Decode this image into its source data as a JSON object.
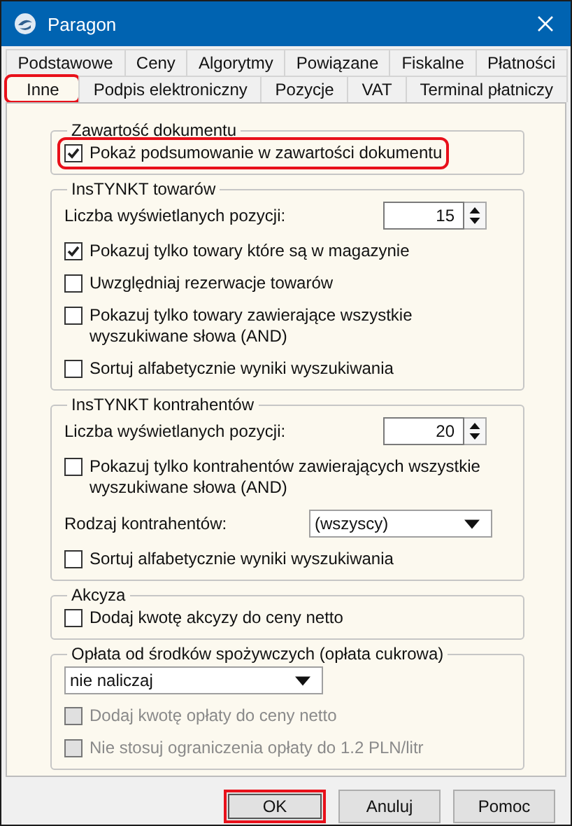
{
  "window": {
    "title": "Paragon"
  },
  "tab_rows": [
    [
      {
        "label": "Podstawowe",
        "selected": false,
        "highlighted": false
      },
      {
        "label": "Ceny",
        "selected": false,
        "highlighted": false
      },
      {
        "label": "Algorytmy",
        "selected": false,
        "highlighted": false
      },
      {
        "label": "Powiązane",
        "selected": false,
        "highlighted": false
      },
      {
        "label": "Fiskalne",
        "selected": false,
        "highlighted": false
      },
      {
        "label": "Płatności",
        "selected": false,
        "highlighted": false
      }
    ],
    [
      {
        "label": "Inne",
        "selected": true,
        "highlighted": true
      },
      {
        "label": "Podpis elektroniczny",
        "selected": false,
        "highlighted": false
      },
      {
        "label": "Pozycje",
        "selected": false,
        "highlighted": false
      },
      {
        "label": "VAT",
        "selected": false,
        "highlighted": false
      },
      {
        "label": "Terminal płatniczy",
        "selected": false,
        "highlighted": false
      }
    ]
  ],
  "groups": [
    {
      "title": "Zawartość dokumentu",
      "items": [
        {
          "kind": "checkbox",
          "label": "Pokaż podsumowanie w zawartości dokumentu",
          "checked": true,
          "disabled": false,
          "highlighted": true
        }
      ]
    },
    {
      "title": "InsTYNKT towarów",
      "items": [
        {
          "kind": "spin",
          "label": "Liczba wyświetlanych pozycji:",
          "value": "15"
        },
        {
          "kind": "checkbox",
          "label": "Pokazuj tylko towary które są w magazynie",
          "checked": true,
          "disabled": false,
          "highlighted": false
        },
        {
          "kind": "checkbox",
          "label": "Uwzględniaj rezerwacje towarów",
          "checked": false,
          "disabled": false,
          "highlighted": false
        },
        {
          "kind": "checkbox",
          "label": "Pokazuj tylko towary zawierające wszystkie wyszukiwane słowa (AND)",
          "checked": false,
          "disabled": false,
          "highlighted": false
        },
        {
          "kind": "checkbox",
          "label": "Sortuj alfabetycznie wyniki wyszukiwania",
          "checked": false,
          "disabled": false,
          "highlighted": false
        }
      ]
    },
    {
      "title": "InsTYNKT kontrahentów",
      "items": [
        {
          "kind": "spin",
          "label": "Liczba wyświetlanych pozycji:",
          "value": "20"
        },
        {
          "kind": "checkbox",
          "label": "Pokazuj tylko kontrahentów zawierających wszystkie wyszukiwane słowa (AND)",
          "checked": false,
          "disabled": false,
          "highlighted": false
        },
        {
          "kind": "select",
          "label": "Rodzaj kontrahentów:",
          "value": "(wszyscy)"
        },
        {
          "kind": "checkbox",
          "label": "Sortuj alfabetycznie wyniki wyszukiwania",
          "checked": false,
          "disabled": false,
          "highlighted": false
        }
      ]
    },
    {
      "title": "Akcyza",
      "items": [
        {
          "kind": "checkbox",
          "label": "Dodaj kwotę akcyzy do ceny netto",
          "checked": false,
          "disabled": false,
          "highlighted": false
        }
      ]
    },
    {
      "title": "Opłata od środków spożywczych (opłata cukrowa)",
      "items": [
        {
          "kind": "select",
          "value": "nie naliczaj"
        },
        {
          "kind": "checkbox",
          "label": "Dodaj kwotę opłaty do ceny netto",
          "checked": false,
          "disabled": true,
          "highlighted": false
        },
        {
          "kind": "checkbox",
          "label": "Nie stosuj ograniczenia opłaty do 1.2 PLN/litr",
          "checked": false,
          "disabled": true,
          "highlighted": false
        }
      ]
    }
  ],
  "buttons": [
    {
      "label": "OK",
      "default": true,
      "highlighted": true
    },
    {
      "label": "Anuluj",
      "default": false,
      "highlighted": false
    },
    {
      "label": "Pomoc",
      "default": false,
      "highlighted": false
    }
  ]
}
